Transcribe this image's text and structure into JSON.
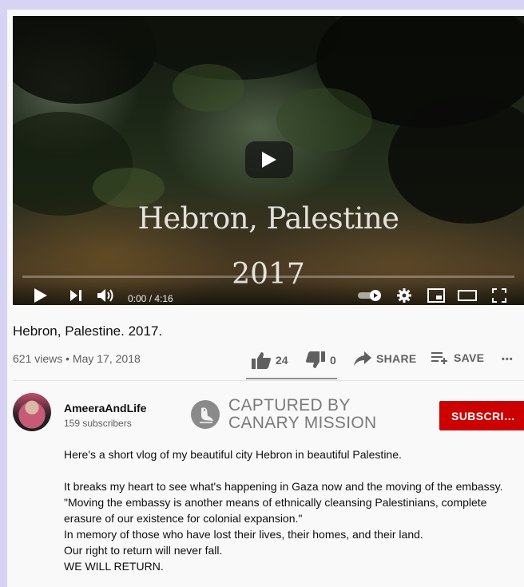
{
  "video": {
    "overlay_line1": "Hebron, Palestine",
    "overlay_line2": "2017",
    "time": "0:00 / 4:16"
  },
  "meta": {
    "title": "Hebron, Palestine. 2017.",
    "stats": "621 views • May 17, 2018",
    "likes": "24",
    "dislikes": "0",
    "share_label": "SHARE",
    "save_label": "SAVE",
    "more": "•••"
  },
  "channel": {
    "name": "AmeeraAndLife",
    "subscribers": "159 subscribers",
    "subscribe_label": "SUBSCRI…"
  },
  "watermark": {
    "line1": "CAPTURED BY",
    "line2": "CANARY MISSION"
  },
  "description": {
    "line1": "Here's a short vlog of my beautiful city Hebron in beautiful Palestine.",
    "line2": "It breaks my heart to see what's happening in Gaza now and the moving of the embassy.",
    "line3": "\"Moving the embassy is another means of ethnically cleansing Palestinians, complete",
    "line4": "erasure of our existence for colonial expansion.\"",
    "line5": "In memory of those who have lost their lives, their homes, and their land.",
    "line6": "Our right to return will never fall.",
    "line7": "WE WILL RETURN."
  },
  "colors": {
    "page_bg": "#d6d3f5",
    "subscribe_bg": "#cc0000",
    "text_primary": "#0f0f0f",
    "text_secondary": "#606060"
  },
  "icons": [
    "play-icon",
    "next-icon",
    "volume-icon",
    "autoplay-toggle-icon",
    "settings-icon",
    "miniplayer-icon",
    "theater-icon",
    "fullscreen-icon",
    "thumbs-up-icon",
    "thumbs-down-icon",
    "share-icon",
    "save-playlist-icon",
    "more-icon",
    "canary-mission-logo"
  ]
}
